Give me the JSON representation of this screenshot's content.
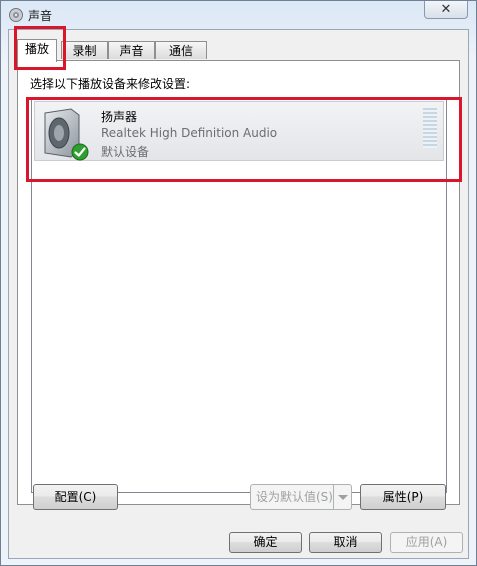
{
  "window": {
    "title": "声音",
    "close_glyph": "✕"
  },
  "tabs": [
    {
      "label": "播放",
      "active": true
    },
    {
      "label": "录制",
      "active": false
    },
    {
      "label": "声音",
      "active": false
    },
    {
      "label": "通信",
      "active": false
    }
  ],
  "playback": {
    "prompt": "选择以下播放设备来修改设置:",
    "device": {
      "name": "扬声器",
      "driver": "Realtek High Definition Audio",
      "status": "默认设备",
      "icon": "speaker-icon",
      "status_icon": "checkmark-icon"
    }
  },
  "buttons": {
    "configure": "配置(C)",
    "set_default": "设为默认值(S)",
    "properties": "属性(P)",
    "ok": "确定",
    "cancel": "取消",
    "apply": "应用(A)"
  },
  "colors": {
    "highlight": "#d9162c",
    "check_green": "#2e9e2e"
  }
}
